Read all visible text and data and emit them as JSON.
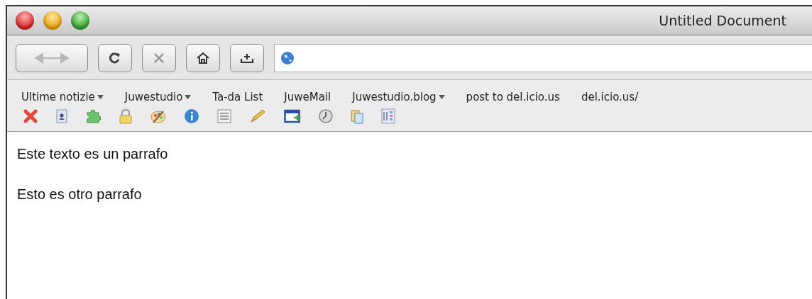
{
  "window": {
    "title": "Untitled Document"
  },
  "bookmarks": [
    {
      "label": "Ultime notizie",
      "dropdown": true
    },
    {
      "label": "Juwestudio",
      "dropdown": true
    },
    {
      "label": "Ta-da List",
      "dropdown": false
    },
    {
      "label": "JuweMail",
      "dropdown": false
    },
    {
      "label": "Juwestudio.blog",
      "dropdown": true
    },
    {
      "label": "post to del.icio.us",
      "dropdown": false
    },
    {
      "label": "del.icio.us/",
      "dropdown": false
    }
  ],
  "content": {
    "paragraphs": [
      "Este texto es un parrafo",
      "Esto es otro parrafo"
    ]
  }
}
